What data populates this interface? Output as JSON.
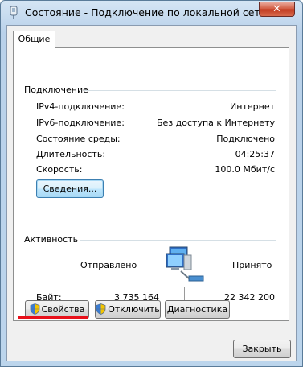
{
  "window": {
    "title": "Состояние - Подключение по локальной сети",
    "close_symbol": "✕",
    "title_icon": "network-adapter-icon"
  },
  "tabs": [
    {
      "label": "Общие"
    }
  ],
  "connection": {
    "heading": "Подключение",
    "rows": [
      {
        "label": "IPv4-подключение:",
        "value": "Интернет"
      },
      {
        "label": "IPv6-подключение:",
        "value": "Без доступа к Интернету"
      },
      {
        "label": "Состояние среды:",
        "value": "Подключено"
      },
      {
        "label": "Длительность:",
        "value": "04:25:37"
      },
      {
        "label": "Скорость:",
        "value": "100.0 Мбит/с"
      }
    ],
    "details_button": "Сведения..."
  },
  "activity": {
    "heading": "Активность",
    "sent_label": "Отправлено",
    "received_label": "Принято",
    "bytes_label": "Байт:",
    "bytes_sent": "3 735 164",
    "bytes_received": "22 342 200",
    "network_icon": "network-computers-icon"
  },
  "buttons": {
    "properties": "Свойства",
    "disable": "Отключить",
    "diagnose": "Диагностика",
    "close": "Закрыть"
  },
  "colors": {
    "highlight_underline": "#e8101a",
    "titlebar": "#bcd5ec"
  }
}
